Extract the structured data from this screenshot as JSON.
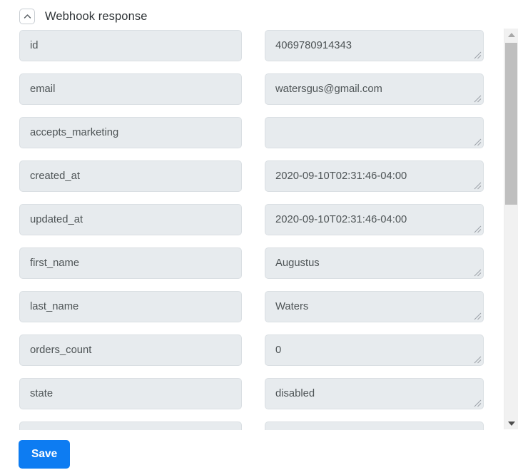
{
  "section": {
    "title": "Webhook response",
    "collapse_icon": "chevron-up-icon",
    "expanded": true
  },
  "fields": [
    {
      "key": "id",
      "value": "4069780914343"
    },
    {
      "key": "email",
      "value": "watersgus@gmail.com"
    },
    {
      "key": "accepts_marketing",
      "value": ""
    },
    {
      "key": "created_at",
      "value": "2020-09-10T02:31:46-04:00"
    },
    {
      "key": "updated_at",
      "value": "2020-09-10T02:31:46-04:00"
    },
    {
      "key": "first_name",
      "value": "Augustus"
    },
    {
      "key": "last_name",
      "value": "Waters"
    },
    {
      "key": "orders_count",
      "value": "0"
    },
    {
      "key": "state",
      "value": "disabled"
    },
    {
      "key": "",
      "value": ""
    }
  ],
  "scrollbar": {
    "up_icon": "triangle-up-icon",
    "down_icon": "triangle-down-icon",
    "orientation": "vertical"
  },
  "footer": {
    "save_label": "Save"
  },
  "colors": {
    "accent": "#0d7cf2",
    "field_background": "#e7ebee",
    "field_border": "#dadfe3",
    "field_text": "#4e5456",
    "title_text": "#2f3437",
    "scrollbar_track": "#f1f1f1",
    "scrollbar_thumb": "#bfbfbf"
  }
}
